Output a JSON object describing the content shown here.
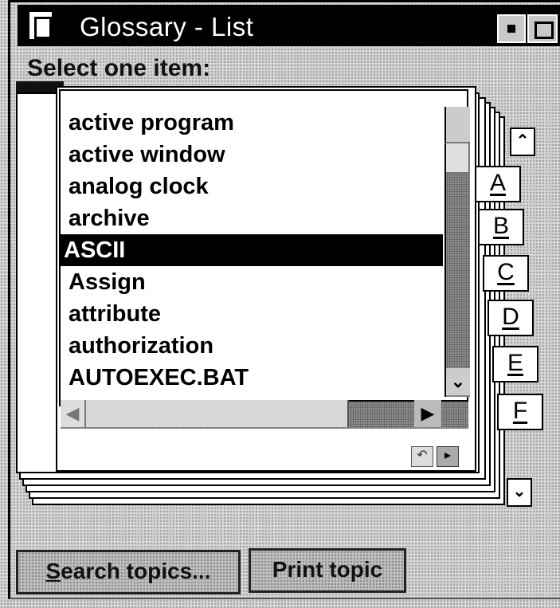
{
  "window": {
    "title": "Glossary - List"
  },
  "prompt": "Select one item:",
  "list": {
    "items": [
      "active program",
      "active window",
      "analog clock",
      "archive",
      "ASCII",
      "Assign",
      "attribute",
      "authorization",
      "AUTOEXEC.BAT"
    ],
    "selected": "ASCII"
  },
  "tabs": [
    "A",
    "B",
    "C",
    "D",
    "E",
    "F"
  ],
  "buttons": {
    "search_first": "S",
    "search_rest": "earch topics...",
    "print": "Print topic"
  },
  "icons": {
    "system_menu": "notebook-icon",
    "minimize": "minimize-icon",
    "maximize": "maximize-icon",
    "tab_scroll_up": "double-up-arrow-icon",
    "tab_scroll_down": "double-down-arrow-icon",
    "page_prev": "page-back-icon",
    "page_next": "page-forward-icon"
  },
  "colors": {
    "selection": "#000000",
    "titlebar": "#000000",
    "background": "#cfcfcf"
  }
}
